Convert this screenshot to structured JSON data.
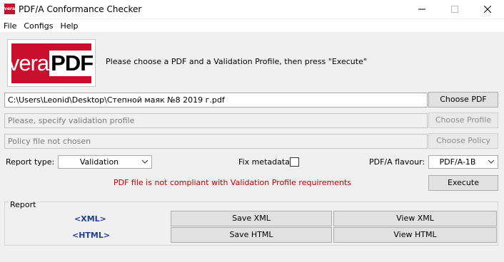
{
  "window": {
    "title": "PDF/A Conformance Checker",
    "icon_label": "vera"
  },
  "menu": [
    "File",
    "Configs",
    "Help"
  ],
  "logo": {
    "part1": "vera",
    "part2": "PDF"
  },
  "instructions": "Please choose a PDF and a Validation Profile, then press \"Execute\"",
  "pdf_path": "C:\\Users\\Leonid\\Desktop\\Степной маяк №8  2019 г.pdf",
  "buttons": {
    "choose_pdf": "Choose PDF",
    "choose_profile": "Choose Profile",
    "choose_policy": "Choose Policy",
    "execute": "Execute",
    "save_xml": "Save XML",
    "view_xml": "View XML",
    "save_html": "Save HTML",
    "view_html": "View HTML"
  },
  "profile_placeholder": "Please, specify validation profile",
  "policy_placeholder": "Policy file not chosen",
  "report_type": {
    "label": "Report type:",
    "value": "Validation"
  },
  "fix_metadata": {
    "label": "Fix metadata:",
    "checked": false
  },
  "flavour": {
    "label": "PDF/A flavour:",
    "value": "PDF/A-1B"
  },
  "status_message": "PDF file is not compliant with Validation Profile requirements",
  "report": {
    "legend": "Report",
    "xml_label": "<XML>",
    "html_label": "<HTML>"
  }
}
